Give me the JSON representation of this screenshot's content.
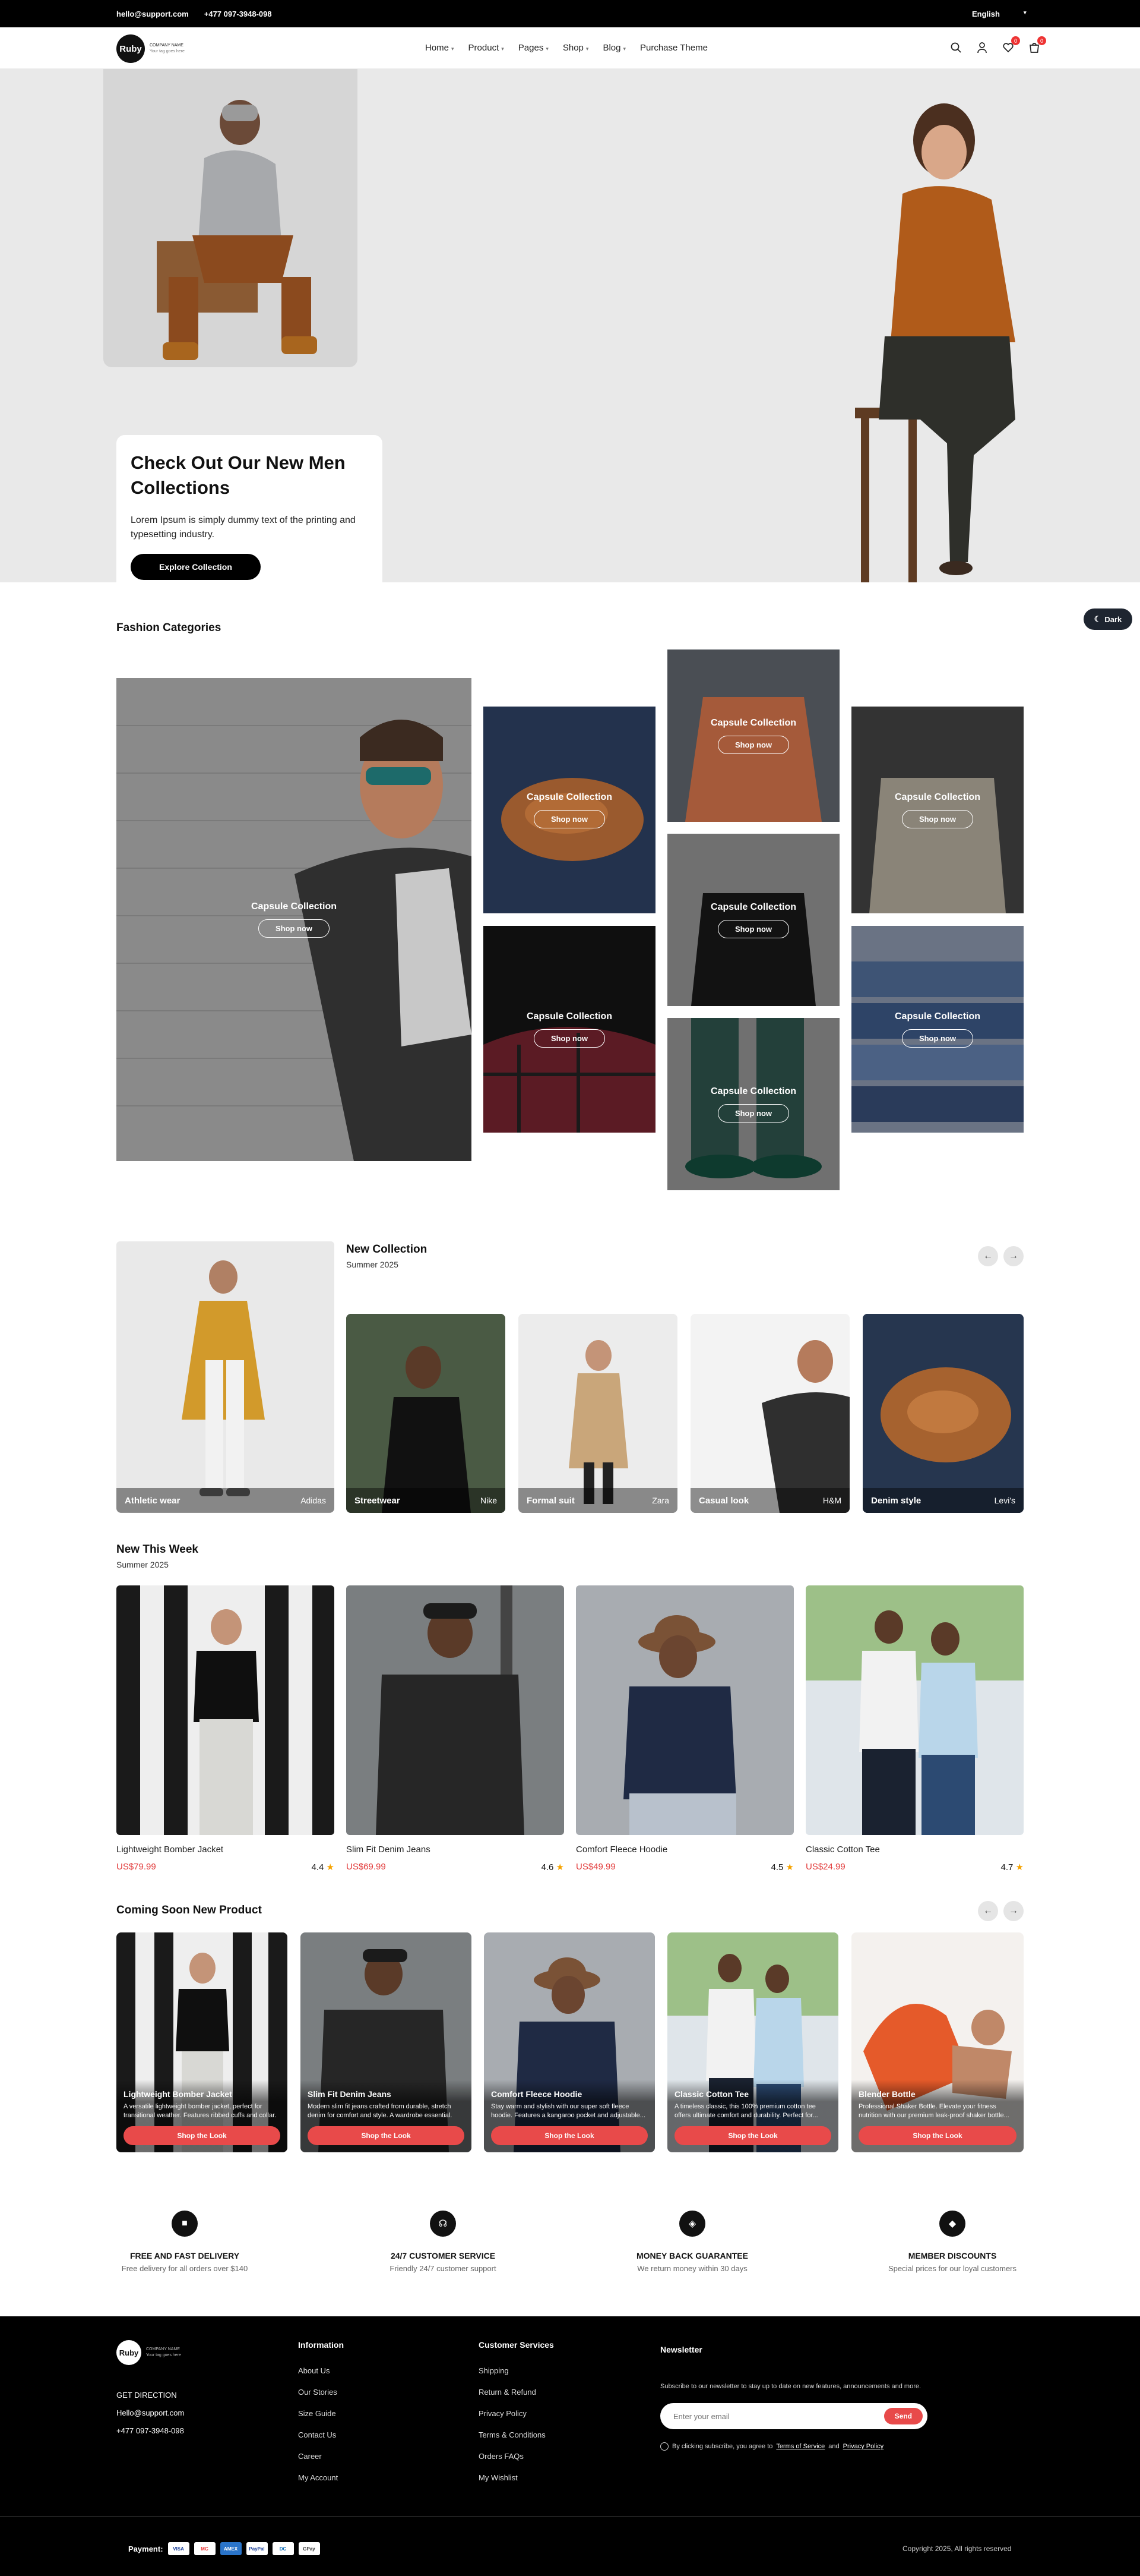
{
  "topbar": {
    "email": "hello@support.com",
    "phone": "+477 097-3948-098",
    "language": "English"
  },
  "header": {
    "logo": {
      "mark": "Ruby",
      "line1": "COMPANY NAME",
      "line2": "Your tag goes here"
    },
    "nav": [
      {
        "label": "Home"
      },
      {
        "label": "Product"
      },
      {
        "label": "Pages"
      },
      {
        "label": "Shop"
      },
      {
        "label": "Blog"
      },
      {
        "label": "Purchase Theme"
      }
    ],
    "wishlist_count": "0",
    "cart_count": "0"
  },
  "hero": {
    "title": "Check Out Our New Men Collections",
    "text": "Lorem Ipsum is simply dummy text of the printing and typesetting industry.",
    "button": "Explore Collection"
  },
  "dark_toggle": "Dark",
  "categories": {
    "title": "Fashion Categories",
    "items": [
      {
        "label": "Capsule Collection",
        "button": "Shop now"
      },
      {
        "label": "Capsule Collection",
        "button": "Shop now"
      },
      {
        "label": "Capsule Collection",
        "button": "Shop now"
      },
      {
        "label": "Capsule Collection",
        "button": "Shop now"
      },
      {
        "label": "Capsule Collection",
        "button": "Shop now"
      },
      {
        "label": "Capsule Collection",
        "button": "Shop now"
      },
      {
        "label": "Capsule Collection",
        "button": "Shop now"
      },
      {
        "label": "Capsule Collection",
        "button": "Shop now"
      },
      {
        "label": "Capsule Collection",
        "button": "Shop now"
      }
    ]
  },
  "new_collection": {
    "title": "New Collection",
    "subtitle": "Summer 2025",
    "items": [
      {
        "name": "Athletic wear",
        "brand": "Adidas"
      },
      {
        "name": "Streetwear",
        "brand": "Nike"
      },
      {
        "name": "Formal suit",
        "brand": "Zara"
      },
      {
        "name": "Casual look",
        "brand": "H&M"
      },
      {
        "name": "Denim style",
        "brand": "Levi's"
      }
    ]
  },
  "new_this_week": {
    "title": "New This Week",
    "subtitle": "Summer 2025",
    "products": [
      {
        "name": "Lightweight Bomber Jacket",
        "price": "US$79.99",
        "rating": "4.4"
      },
      {
        "name": "Slim Fit Denim Jeans",
        "price": "US$69.99",
        "rating": "4.6"
      },
      {
        "name": "Comfort Fleece Hoodie",
        "price": "US$49.99",
        "rating": "4.5"
      },
      {
        "name": "Classic Cotton Tee",
        "price": "US$24.99",
        "rating": "4.7"
      }
    ]
  },
  "coming_soon": {
    "title": "Coming Soon New Product",
    "items": [
      {
        "name": "Lightweight Bomber Jacket",
        "desc": "A versatile lightweight bomber jacket, perfect for transitional weather. Features ribbed cuffs and collar.",
        "button": "Shop the Look"
      },
      {
        "name": "Slim Fit Denim Jeans",
        "desc": "Modern slim fit jeans crafted from durable, stretch denim for comfort and style. A wardrobe essential.",
        "button": "Shop the Look"
      },
      {
        "name": "Comfort Fleece Hoodie",
        "desc": "Stay warm and stylish with our super soft fleece hoodie. Features a kangaroo pocket and adjustable...",
        "button": "Shop the Look"
      },
      {
        "name": "Classic Cotton Tee",
        "desc": "A timeless classic, this 100% premium cotton tee offers ultimate comfort and durability. Perfect for...",
        "button": "Shop the Look"
      },
      {
        "name": "Blender Bottle",
        "desc": "Professional Shaker Bottle. Elevate your fitness nutrition with our premium leak-proof shaker bottle...",
        "button": "Shop the Look"
      }
    ]
  },
  "features": [
    {
      "title": "FREE AND FAST DELIVERY",
      "desc": "Free delivery for all orders over $140"
    },
    {
      "title": "24/7 CUSTOMER SERVICE",
      "desc": "Friendly 24/7 customer support"
    },
    {
      "title": "MONEY BACK GUARANTEE",
      "desc": "We return money within 30 days"
    },
    {
      "title": "MEMBER DISCOUNTS",
      "desc": "Special prices for our loyal customers"
    }
  ],
  "footer": {
    "direction_label": "GET DIRECTION",
    "email": "Hello@support.com",
    "phone": "+477 097-3948-098",
    "information": {
      "title": "Information",
      "links": [
        "About Us",
        "Our Stories",
        "Size Guide",
        "Contact Us",
        "Career",
        "My Account"
      ]
    },
    "services": {
      "title": "Customer Services",
      "links": [
        "Shipping",
        "Return & Refund",
        "Privacy Policy",
        "Terms & Conditions",
        "Orders FAQs",
        "My Wishlist"
      ]
    },
    "newsletter": {
      "title": "Newsletter",
      "text": "Subscribe to our newsletter to stay up to date on new features, announcements and more.",
      "placeholder": "Enter your email",
      "button": "Send",
      "agree_prefix": "By clicking subscribe, you agree to",
      "terms": "Terms of Service",
      "and": "and",
      "privacy": "Privacy Policy"
    },
    "payment_label": "Payment:",
    "payments": [
      "VISA",
      "MC",
      "AMEX",
      "PayPal",
      "DC",
      "GPay"
    ],
    "copyright": "Copyright 2025, All rights reserved"
  },
  "colors": {
    "accent": "#e84a4a",
    "price": "#e23b3b",
    "dark": "#000000"
  }
}
